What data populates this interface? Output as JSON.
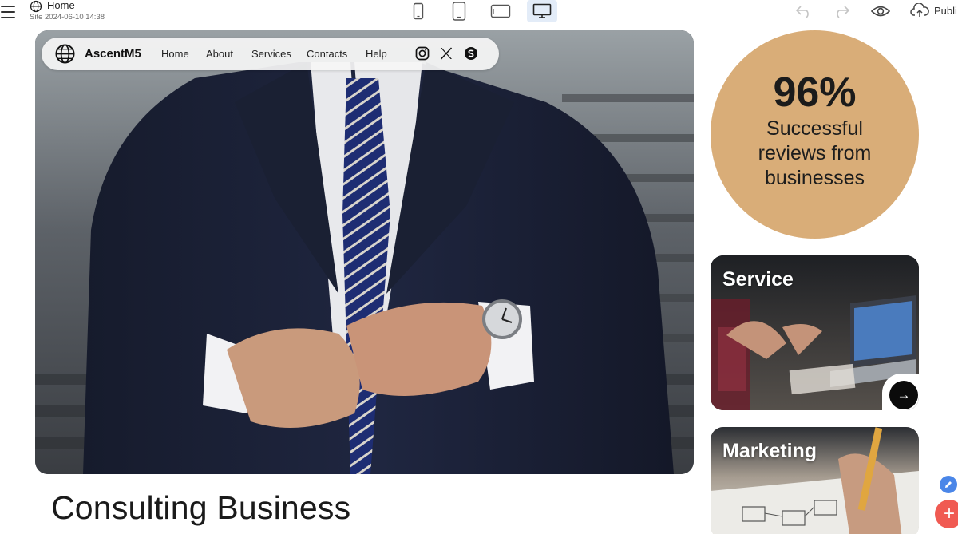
{
  "editor": {
    "site_name": "Home",
    "site_meta": "Site 2024-06-10 14:38",
    "publish_label": "Publi",
    "devices": [
      {
        "name": "phone-small",
        "icon": "phone-portrait-icon"
      },
      {
        "name": "phone",
        "icon": "phone-large-icon"
      },
      {
        "name": "tablet",
        "icon": "tablet-landscape-icon"
      },
      {
        "name": "desktop",
        "icon": "desktop-monitor-icon",
        "active": true
      }
    ]
  },
  "site": {
    "brand": "AscentM5",
    "nav": [
      "Home",
      "About",
      "Services",
      "Contacts",
      "Help"
    ],
    "social": [
      "instagram-icon",
      "x-twitter-icon",
      "skype-icon"
    ],
    "headline": "Consulting Business",
    "stat": {
      "value": "96%",
      "label": "Successful reviews from businesses"
    },
    "cards": [
      {
        "title": "Service",
        "action_icon": "arrow-right-icon"
      },
      {
        "title": "Marketing"
      }
    ]
  },
  "colors": {
    "accent_tan": "#d9ad78",
    "active_device_bg": "#e3ecf8",
    "fab_add": "#f05a52",
    "fab_edit": "#4a86e8"
  }
}
